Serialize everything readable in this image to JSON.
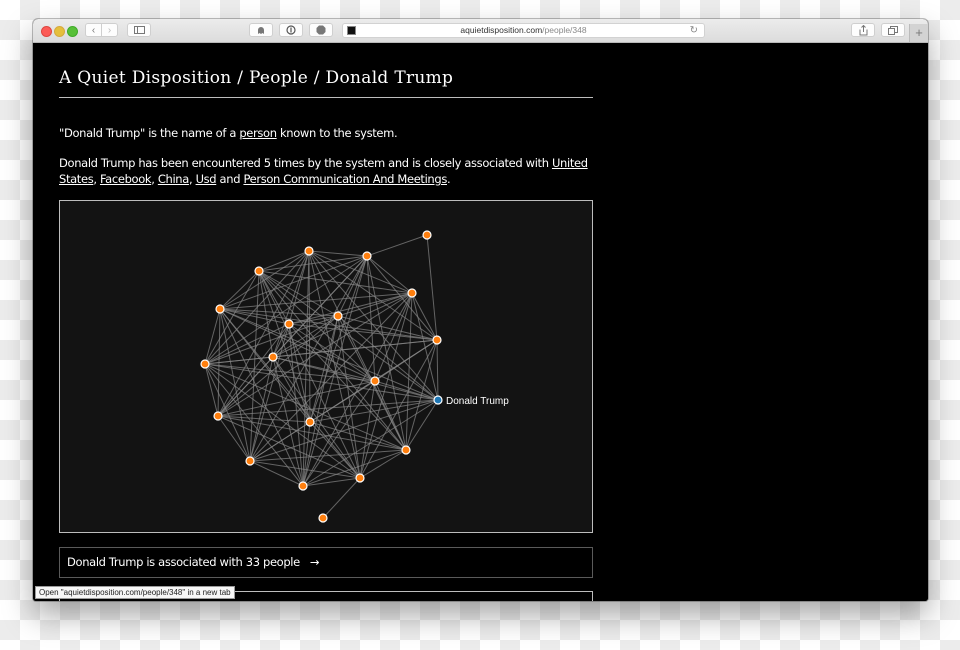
{
  "browser": {
    "url_domain": "aquietdisposition.com",
    "url_path": "/people/348",
    "icons": {
      "back": "‹",
      "forward": "›",
      "sidebar": "sidebar-icon",
      "ghostery": "ghost-icon",
      "onepassword": "1password-icon",
      "adblock": "adblock-icon",
      "reload": "↻",
      "share": "share-icon",
      "tabs": "tabs-icon",
      "new_tab": "+"
    }
  },
  "page": {
    "title": "A Quiet Disposition / People / Donald Trump",
    "intro": {
      "prefix": "\"Donald Trump\" is the name of a ",
      "link": "person",
      "suffix": " known to the system."
    },
    "summary": {
      "prefix": "Donald Trump has been encountered 5 times by the system and is closely associated with ",
      "links": [
        "United States",
        "Facebook",
        "China",
        "Usd",
        "Person Communication And Meetings"
      ],
      "sep1": ", ",
      "sep_and": " and ",
      "end": "."
    },
    "association_link": {
      "label": "Donald Trump is associated with 33 people",
      "arrow": "→"
    },
    "tooltip": "Open \"aquietdisposition.com/people/348\" in a new tab"
  },
  "graph": {
    "focus_label": "Donald Trump",
    "colors": {
      "node": "#ff7f0e",
      "focus_node": "#1f77b4",
      "node_stroke": "#ffffff",
      "edge": "#888888"
    },
    "node_count": 21
  }
}
